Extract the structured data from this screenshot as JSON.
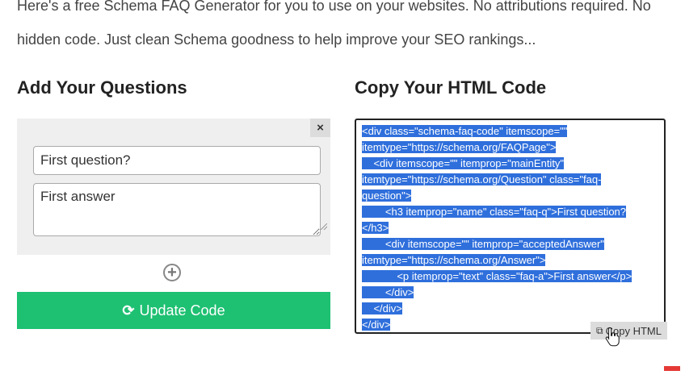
{
  "intro": {
    "line1": "Here's a free Schema FAQ Generator for you to use on your websites. No attributions required. No",
    "line2": "hidden code. Just clean Schema goodness to help improve your SEO rankings..."
  },
  "left": {
    "title": "Add Your Questions",
    "close_label": "×",
    "question_value": "First question?",
    "answer_value": "First answer",
    "add_label": "+",
    "update_label": "Update Code",
    "update_icon": "⟳"
  },
  "right": {
    "title": "Copy Your HTML Code",
    "code_lines": [
      "<div class=\"schema-faq-code\" itemscope=\"\"",
      "itemtype=\"https://schema.org/FAQPage\">",
      "    <div itemscope=\"\" itemprop=\"mainEntity\"",
      "itemtype=\"https://schema.org/Question\" class=\"faq-",
      "question\">",
      "        <h3 itemprop=\"name\" class=\"faq-q\">First question?",
      "</h3>",
      "        <div itemscope=\"\" itemprop=\"acceptedAnswer\"",
      "itemtype=\"https://schema.org/Answer\">",
      "            <p itemprop=\"text\" class=\"faq-a\">First answer</p>",
      "        </div>",
      "    </div>",
      "</div>"
    ],
    "copy_label": "Copy HTML",
    "copy_icon": "copy-icon"
  },
  "colors": {
    "accent_green": "#1ec072",
    "selection_blue": "#2f6fdc"
  }
}
